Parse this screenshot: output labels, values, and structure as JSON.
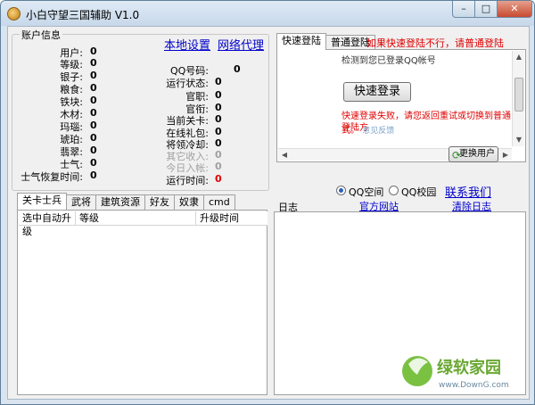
{
  "window": {
    "title": "小白守望三国辅助 V1.0",
    "min": "–",
    "max": "□",
    "close": "✕"
  },
  "account": {
    "group_label": "账户信息",
    "links": {
      "local_settings": "本地设置",
      "network_proxy": "网络代理"
    },
    "left_fields": [
      {
        "label": "用户:",
        "value": "0"
      },
      {
        "label": "等级:",
        "value": "0"
      },
      {
        "label": "银子:",
        "value": "0"
      },
      {
        "label": "粮食:",
        "value": "0"
      },
      {
        "label": "铁块:",
        "value": "0"
      },
      {
        "label": "木材:",
        "value": "0"
      },
      {
        "label": "玛瑙:",
        "value": "0"
      },
      {
        "label": "琥珀:",
        "value": "0"
      },
      {
        "label": "翡翠:",
        "value": "0"
      },
      {
        "label": "士气:",
        "value": "0"
      },
      {
        "label": "士气恢复时间:",
        "value": "0"
      }
    ],
    "right_fields": [
      {
        "label": "QQ号码:",
        "value": "0"
      },
      {
        "label": "运行状态:",
        "value": "0"
      },
      {
        "label": "官职:",
        "value": "0"
      },
      {
        "label": "官衔:",
        "value": "0"
      },
      {
        "label": "当前关卡:",
        "value": "0"
      },
      {
        "label": "在线礼包:",
        "value": "0"
      },
      {
        "label": "将领冷却:",
        "value": "0"
      },
      {
        "label": "其它收入:",
        "value": "0"
      },
      {
        "label": "今日入帐:",
        "value": "0"
      },
      {
        "label": "运行时间:",
        "value": "0"
      }
    ]
  },
  "login": {
    "tabs": [
      "快速登陆",
      "普通登陆"
    ],
    "hint": "如果快速登陆不行，请普通登陆",
    "detected": "检测到您已登录QQ帐号",
    "quick_button": "快速登录",
    "fail_msg": "快速登录失败，请您返回重试或切换到普通登陆方",
    "fail_msg2": "式。",
    "feedback": "意见反馈",
    "switch_user": "更换用户"
  },
  "radios": {
    "qzone": "QQ空间",
    "campus": "QQ校园",
    "contact": "联系我们"
  },
  "log": {
    "label": "日志",
    "official_site": "官方网站",
    "clear": "清除日志"
  },
  "bottom_tabs": [
    "关卡士兵",
    "武将",
    "建筑资源",
    "好友",
    "奴隶",
    "cmd"
  ],
  "list_columns": [
    "选中自动升级",
    "等级",
    "升级时间"
  ],
  "watermark": {
    "brand": "绿软家园",
    "url": "www.DownG.com"
  },
  "colors": {
    "link": "#0000cc",
    "hint_red": "#e00000"
  }
}
